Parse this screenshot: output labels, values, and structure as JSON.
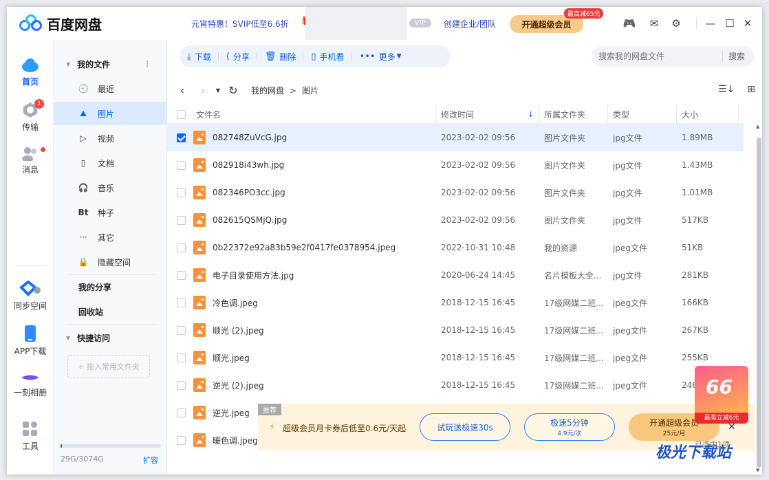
{
  "app": {
    "name": "百度网盘"
  },
  "header": {
    "promo": "元宵特惠！SVIP低至6.6折",
    "vip_tag": "VIP",
    "enterprise": "创建企业/团队",
    "open_vip": "开通超级会员",
    "discount_badge": "最高减65元"
  },
  "leftnav": {
    "items": [
      {
        "label": "首页",
        "icon": "cloud-icon"
      },
      {
        "label": "传输",
        "icon": "transfer-icon",
        "badge": "1"
      },
      {
        "label": "消息",
        "icon": "message-icon"
      },
      {
        "label": "同步空间",
        "icon": "sync-icon"
      },
      {
        "label": "APP下载",
        "icon": "phone-icon"
      },
      {
        "label": "一刻相册",
        "icon": "album-icon"
      },
      {
        "label": "工具",
        "icon": "tools-icon"
      }
    ]
  },
  "tree": {
    "my_files": "我的文件",
    "items": [
      {
        "label": "最近",
        "icon": "clock-icon"
      },
      {
        "label": "图片",
        "icon": "image-icon"
      },
      {
        "label": "视频",
        "icon": "play-icon"
      },
      {
        "label": "文档",
        "icon": "doc-icon"
      },
      {
        "label": "音乐",
        "icon": "headphone-icon"
      },
      {
        "label": "种子",
        "icon": "bt-icon"
      },
      {
        "label": "其它",
        "icon": "more-icon"
      },
      {
        "label": "隐藏空间",
        "icon": "lock-icon"
      }
    ],
    "my_share": "我的分享",
    "recycle": "回收站",
    "quick_access": "快捷访问",
    "drop_zone": "+ 拖入常用文件夹",
    "quota": "29G/3074G",
    "expand": "扩容",
    "quota_used_fraction": 0.0094
  },
  "toolbar": {
    "download": "下载",
    "share": "分享",
    "delete": "删除",
    "phone": "手机看",
    "more": "更多"
  },
  "search": {
    "placeholder": "搜索我的网盘文件",
    "button": "搜索"
  },
  "breadcrumb": {
    "root": "我的网盘",
    "current": "图片"
  },
  "table": {
    "headers": [
      "文件名",
      "修改时间",
      "所属文件夹",
      "类型",
      "大小"
    ],
    "rows": [
      {
        "name": "082748ZuVcG.jpg",
        "time": "2023-02-02 09:56",
        "folder": "图片文件夹",
        "type": "jpg文件",
        "size": "1.89MB",
        "checked": true
      },
      {
        "name": "082918i43wh.jpg",
        "time": "2023-02-02 09:56",
        "folder": "图片文件夹",
        "type": "jpg文件",
        "size": "1.43MB"
      },
      {
        "name": "082346PO3cc.jpg",
        "time": "2023-02-02 09:56",
        "folder": "图片文件夹",
        "type": "jpg文件",
        "size": "1.01MB"
      },
      {
        "name": "082615QSMjQ.jpg",
        "time": "2023-02-02 09:56",
        "folder": "图片文件夹",
        "type": "jpg文件",
        "size": "517KB"
      },
      {
        "name": "0b22372e92a83b59e2f0417fe0378954.jpeg",
        "time": "2022-10-31 10:48",
        "folder": "我的资源",
        "type": "jpeg文件",
        "size": "51KB"
      },
      {
        "name": "电子目录使用方法.jpg",
        "time": "2020-06-24 14:45",
        "folder": "名片模板大全...",
        "type": "jpg文件",
        "size": "281KB"
      },
      {
        "name": "冷色调.jpeg",
        "time": "2018-12-15 16:45",
        "folder": "17级网媒二班...",
        "type": "jpeg文件",
        "size": "166KB"
      },
      {
        "name": "顺光 (2).jpeg",
        "time": "2018-12-15 16:45",
        "folder": "17级网媒二班...",
        "type": "jpeg文件",
        "size": "267KB"
      },
      {
        "name": "顺光.jpeg",
        "time": "2018-12-15 16:45",
        "folder": "17级网媒二班...",
        "type": "jpeg文件",
        "size": "255KB"
      },
      {
        "name": "逆光 (2).jpeg",
        "time": "2018-12-15 16:45",
        "folder": "17级网媒二班...",
        "type": "jpeg文件",
        "size": "246"
      },
      {
        "name": "逆光.jpeg",
        "time": "",
        "folder": "",
        "type": "",
        "size": ""
      },
      {
        "name": "暖色调.jpeg",
        "time": "",
        "folder": "",
        "type": "",
        "size": ""
      }
    ]
  },
  "banner": {
    "tag": "推荐",
    "text": "超级会员月卡券后低至0.6元/天起",
    "trial": "试玩送极速30s",
    "speed": "极速5分钟",
    "speed_price": "4.9元/次",
    "open": "开通超级会员",
    "open_price": "25元/月"
  },
  "promo_badge": {
    "number": "66",
    "caption": "最高立减6元"
  },
  "watermark": {
    "brand": "极光下载站"
  },
  "status_hint": "已选中1项",
  "colors": {
    "accent": "#0a64ff",
    "vip_gold": "#f7c98a",
    "file_orange": "#f7923a"
  }
}
